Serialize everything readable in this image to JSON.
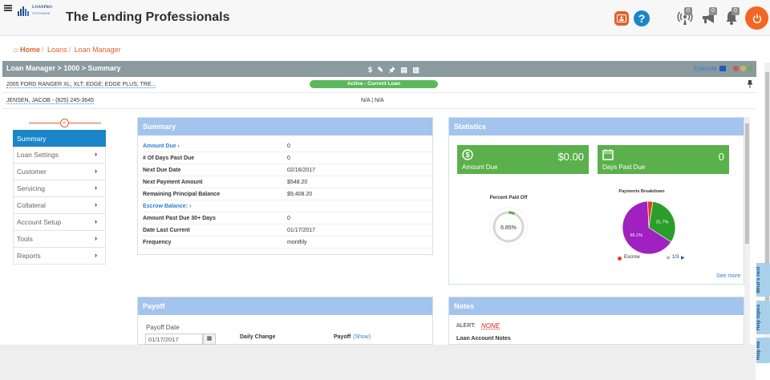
{
  "app": {
    "title": "The Lending Professionals",
    "logo_text": "LOANPRO",
    "logo_sub": "SOFTWARE"
  },
  "header_badges": {
    "broadcast": "0",
    "megaphone": "0",
    "bell": "0"
  },
  "breadcrumb": {
    "home": "Home",
    "loans": "Loans",
    "current": "Loan Manager",
    "sep": "/"
  },
  "loan_bar": {
    "title": "Loan Manager > 1000 > Summary",
    "tools": "$ ✎ 🖈 ▤ ▥",
    "execute_label": "Execute"
  },
  "loan_info": {
    "vehicle": "2005 FORD RANGER XL; XLT; EDGE; EDGE PLUS; TRE...",
    "status": "Active - Current Loan",
    "borrower": "JENSEN, JACOB - (825) 245-3645",
    "na": "N/A | N/A"
  },
  "nav": {
    "toggle": "«",
    "items": [
      {
        "label": "Summary",
        "chev": ""
      },
      {
        "label": "Loan Settings",
        "chev": "›"
      },
      {
        "label": "Customer",
        "chev": "›"
      },
      {
        "label": "Servicing",
        "chev": "›"
      },
      {
        "label": "Collateral",
        "chev": "›"
      },
      {
        "label": "Account Setup",
        "chev": "›"
      },
      {
        "label": "Tools",
        "chev": "›"
      },
      {
        "label": "Reports",
        "chev": "›"
      }
    ]
  },
  "summary": {
    "title": "Summary",
    "rows": [
      {
        "k": "Amount Due ›",
        "v": "0"
      },
      {
        "k": "# Of Days Past Due",
        "v": "0"
      },
      {
        "k": "Next Due Date",
        "v": "02/16/2017"
      },
      {
        "k": "Next Payment Amount",
        "v": "$548.20"
      },
      {
        "k": "Remaining Principal Balance",
        "v": "$9,408.20"
      },
      {
        "k": "Escrow Balance: ›",
        "v": ""
      },
      {
        "k": "Amount Past Due 30+ Days",
        "v": "0"
      },
      {
        "k": "Date Last Current",
        "v": "01/17/2017"
      },
      {
        "k": "Frequency",
        "v": "monthly"
      }
    ]
  },
  "statistics": {
    "title": "Statistics",
    "amount_due_value": "$0.00",
    "amount_due_label": "Amount Due",
    "days_past_due_value": "0",
    "days_past_due_label": "Days Past Due",
    "percent_paid_caption": "Percent Paid Off",
    "percent_paid_value": "6.85%",
    "percent_paid_fraction": 0.0685,
    "breakdown_caption": "Payments Breakdown",
    "legend_label": "Escrow",
    "pager": "1/3",
    "see_more": "See more",
    "colors": {
      "slice_a": "#a020c0",
      "slice_b": "#2a9d2a",
      "slice_c": "#e04020",
      "accent": "#5ab04a"
    }
  },
  "chart_data": {
    "type": "pie",
    "title": "Payments Breakdown",
    "slices": [
      {
        "value": 65.1,
        "label": "65.1%",
        "color": "#a020c0"
      },
      {
        "value": 31.7,
        "label": "31.7%",
        "color": "#2a9d2a"
      },
      {
        "value": 3.2,
        "label": "",
        "color": "#e04020"
      }
    ],
    "legend": [
      "Escrow"
    ]
  },
  "payoff": {
    "title": "Payoff",
    "date_label": "Payoff Date",
    "date_value": "01/17/2017",
    "daily_change": "Daily Change",
    "payoff_label": "Payoff",
    "show_link": "(Show)"
  },
  "notes": {
    "title": "Notes",
    "alert_label": "ALERT:",
    "alert_value": "NONE",
    "loan_notes": "Loan Account Notes"
  },
  "side_tabs": {
    "whats_next": "What's next",
    "help_topics": "Help topics",
    "help_me": "Help me"
  }
}
